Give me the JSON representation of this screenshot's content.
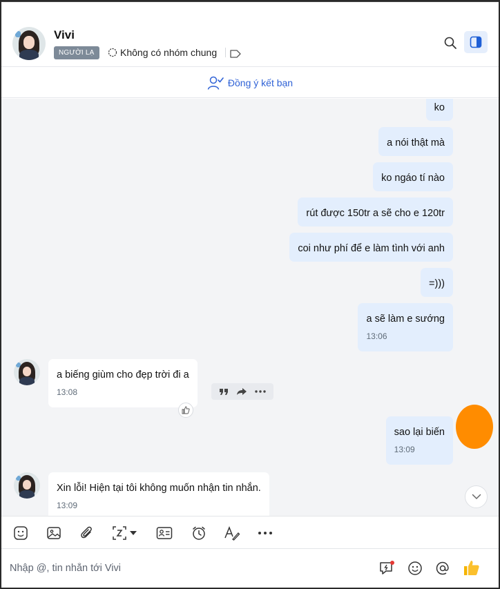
{
  "header": {
    "name": "Vivi",
    "badge": "NGƯỜI LẠ",
    "group_info": "Không có nhóm chung"
  },
  "friend_bar": {
    "label": "Đồng ý kết bạn"
  },
  "messages_out_top": [
    {
      "text": "ko"
    },
    {
      "text": "a nói thật mà"
    },
    {
      "text": "ko ngáo tí nào"
    },
    {
      "text": "rút được 150tr a sẽ cho e 120tr"
    },
    {
      "text": "coi như phí để e làm tình với anh"
    },
    {
      "text": "=)))"
    },
    {
      "text": "a sẽ làm e sướng",
      "time": "13:06"
    }
  ],
  "message_in_1": {
    "text": "a biếng giùm cho đẹp trời đi a",
    "time": "13:08"
  },
  "message_out_2": {
    "text": "sao lại biến",
    "time": "13:09"
  },
  "message_in_2": {
    "text": "Xin lỗi! Hiện tại tôi không muốn nhận tin nhắn.",
    "time": "13:09"
  },
  "composer": {
    "placeholder": "Nhập @, tin nhắn tới Vivi"
  },
  "colors": {
    "accent": "#2f62d6",
    "outgoing_bubble": "#e3eefd",
    "chat_background": "#f3f4f6",
    "badge": "#7d8a98",
    "overlay_blob": "#ff8c00"
  },
  "icons": [
    "search-icon",
    "sidebar-panel-icon",
    "add-friend-icon",
    "tag-icon",
    "sticker-icon",
    "image-icon",
    "attachment-icon",
    "screenshot-icon",
    "contact-card-icon",
    "reminder-icon",
    "text-format-icon",
    "more-icon",
    "quick-message-icon",
    "emoji-icon",
    "mention-icon",
    "thumbs-up-icon"
  ]
}
